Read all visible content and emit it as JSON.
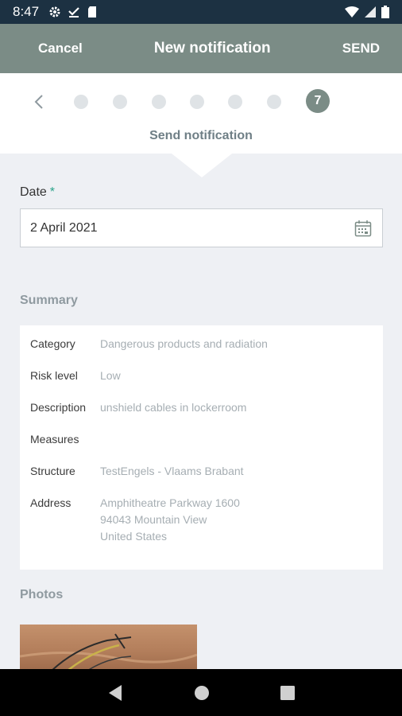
{
  "status_bar": {
    "time": "8:47",
    "icons_left": [
      "gear-icon",
      "download-check-icon",
      "sim-card-icon"
    ],
    "icons_right": [
      "wifi-icon",
      "signal-icon",
      "battery-icon"
    ]
  },
  "app_bar": {
    "cancel_label": "Cancel",
    "title": "New notification",
    "send_label": "SEND"
  },
  "stepper": {
    "total_steps": 7,
    "current_step": "7",
    "label": "Send notification"
  },
  "date": {
    "label": "Date",
    "required_marker": "*",
    "value": "2 April 2021"
  },
  "summary": {
    "title": "Summary",
    "rows": [
      {
        "key": "Category",
        "value": "Dangerous products and radiation"
      },
      {
        "key": "Risk level",
        "value": "Low"
      },
      {
        "key": "Description",
        "value": "unshield cables in lockerroom"
      },
      {
        "key": "Measures",
        "value": ""
      },
      {
        "key": "Structure",
        "value": "TestEngels - Vlaams Brabant"
      }
    ],
    "address": {
      "key": "Address",
      "lines": [
        "Amphitheatre Parkway 1600",
        "94043 Mountain View",
        "United States"
      ]
    }
  },
  "photos": {
    "title": "Photos"
  },
  "colors": {
    "status_bar": "#1c3142",
    "app_bar": "#7b8c86",
    "accent_required": "#2aa38a",
    "background": "#eef0f4"
  }
}
